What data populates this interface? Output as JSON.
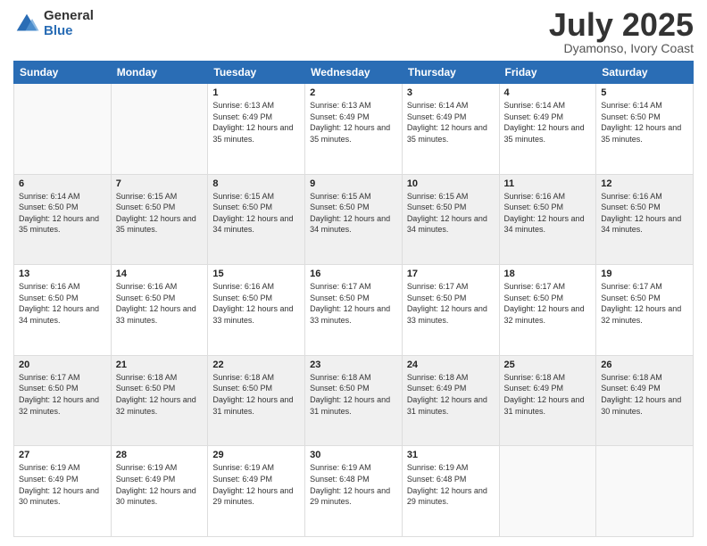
{
  "logo": {
    "general": "General",
    "blue": "Blue"
  },
  "title": {
    "month": "July 2025",
    "location": "Dyamonso, Ivory Coast"
  },
  "weekdays": [
    "Sunday",
    "Monday",
    "Tuesday",
    "Wednesday",
    "Thursday",
    "Friday",
    "Saturday"
  ],
  "weeks": [
    [
      {
        "day": "",
        "sunrise": "",
        "sunset": "",
        "daylight": ""
      },
      {
        "day": "",
        "sunrise": "",
        "sunset": "",
        "daylight": ""
      },
      {
        "day": "1",
        "sunrise": "Sunrise: 6:13 AM",
        "sunset": "Sunset: 6:49 PM",
        "daylight": "Daylight: 12 hours and 35 minutes."
      },
      {
        "day": "2",
        "sunrise": "Sunrise: 6:13 AM",
        "sunset": "Sunset: 6:49 PM",
        "daylight": "Daylight: 12 hours and 35 minutes."
      },
      {
        "day": "3",
        "sunrise": "Sunrise: 6:14 AM",
        "sunset": "Sunset: 6:49 PM",
        "daylight": "Daylight: 12 hours and 35 minutes."
      },
      {
        "day": "4",
        "sunrise": "Sunrise: 6:14 AM",
        "sunset": "Sunset: 6:49 PM",
        "daylight": "Daylight: 12 hours and 35 minutes."
      },
      {
        "day": "5",
        "sunrise": "Sunrise: 6:14 AM",
        "sunset": "Sunset: 6:50 PM",
        "daylight": "Daylight: 12 hours and 35 minutes."
      }
    ],
    [
      {
        "day": "6",
        "sunrise": "Sunrise: 6:14 AM",
        "sunset": "Sunset: 6:50 PM",
        "daylight": "Daylight: 12 hours and 35 minutes."
      },
      {
        "day": "7",
        "sunrise": "Sunrise: 6:15 AM",
        "sunset": "Sunset: 6:50 PM",
        "daylight": "Daylight: 12 hours and 35 minutes."
      },
      {
        "day": "8",
        "sunrise": "Sunrise: 6:15 AM",
        "sunset": "Sunset: 6:50 PM",
        "daylight": "Daylight: 12 hours and 34 minutes."
      },
      {
        "day": "9",
        "sunrise": "Sunrise: 6:15 AM",
        "sunset": "Sunset: 6:50 PM",
        "daylight": "Daylight: 12 hours and 34 minutes."
      },
      {
        "day": "10",
        "sunrise": "Sunrise: 6:15 AM",
        "sunset": "Sunset: 6:50 PM",
        "daylight": "Daylight: 12 hours and 34 minutes."
      },
      {
        "day": "11",
        "sunrise": "Sunrise: 6:16 AM",
        "sunset": "Sunset: 6:50 PM",
        "daylight": "Daylight: 12 hours and 34 minutes."
      },
      {
        "day": "12",
        "sunrise": "Sunrise: 6:16 AM",
        "sunset": "Sunset: 6:50 PM",
        "daylight": "Daylight: 12 hours and 34 minutes."
      }
    ],
    [
      {
        "day": "13",
        "sunrise": "Sunrise: 6:16 AM",
        "sunset": "Sunset: 6:50 PM",
        "daylight": "Daylight: 12 hours and 34 minutes."
      },
      {
        "day": "14",
        "sunrise": "Sunrise: 6:16 AM",
        "sunset": "Sunset: 6:50 PM",
        "daylight": "Daylight: 12 hours and 33 minutes."
      },
      {
        "day": "15",
        "sunrise": "Sunrise: 6:16 AM",
        "sunset": "Sunset: 6:50 PM",
        "daylight": "Daylight: 12 hours and 33 minutes."
      },
      {
        "day": "16",
        "sunrise": "Sunrise: 6:17 AM",
        "sunset": "Sunset: 6:50 PM",
        "daylight": "Daylight: 12 hours and 33 minutes."
      },
      {
        "day": "17",
        "sunrise": "Sunrise: 6:17 AM",
        "sunset": "Sunset: 6:50 PM",
        "daylight": "Daylight: 12 hours and 33 minutes."
      },
      {
        "day": "18",
        "sunrise": "Sunrise: 6:17 AM",
        "sunset": "Sunset: 6:50 PM",
        "daylight": "Daylight: 12 hours and 32 minutes."
      },
      {
        "day": "19",
        "sunrise": "Sunrise: 6:17 AM",
        "sunset": "Sunset: 6:50 PM",
        "daylight": "Daylight: 12 hours and 32 minutes."
      }
    ],
    [
      {
        "day": "20",
        "sunrise": "Sunrise: 6:17 AM",
        "sunset": "Sunset: 6:50 PM",
        "daylight": "Daylight: 12 hours and 32 minutes."
      },
      {
        "day": "21",
        "sunrise": "Sunrise: 6:18 AM",
        "sunset": "Sunset: 6:50 PM",
        "daylight": "Daylight: 12 hours and 32 minutes."
      },
      {
        "day": "22",
        "sunrise": "Sunrise: 6:18 AM",
        "sunset": "Sunset: 6:50 PM",
        "daylight": "Daylight: 12 hours and 31 minutes."
      },
      {
        "day": "23",
        "sunrise": "Sunrise: 6:18 AM",
        "sunset": "Sunset: 6:50 PM",
        "daylight": "Daylight: 12 hours and 31 minutes."
      },
      {
        "day": "24",
        "sunrise": "Sunrise: 6:18 AM",
        "sunset": "Sunset: 6:49 PM",
        "daylight": "Daylight: 12 hours and 31 minutes."
      },
      {
        "day": "25",
        "sunrise": "Sunrise: 6:18 AM",
        "sunset": "Sunset: 6:49 PM",
        "daylight": "Daylight: 12 hours and 31 minutes."
      },
      {
        "day": "26",
        "sunrise": "Sunrise: 6:18 AM",
        "sunset": "Sunset: 6:49 PM",
        "daylight": "Daylight: 12 hours and 30 minutes."
      }
    ],
    [
      {
        "day": "27",
        "sunrise": "Sunrise: 6:19 AM",
        "sunset": "Sunset: 6:49 PM",
        "daylight": "Daylight: 12 hours and 30 minutes."
      },
      {
        "day": "28",
        "sunrise": "Sunrise: 6:19 AM",
        "sunset": "Sunset: 6:49 PM",
        "daylight": "Daylight: 12 hours and 30 minutes."
      },
      {
        "day": "29",
        "sunrise": "Sunrise: 6:19 AM",
        "sunset": "Sunset: 6:49 PM",
        "daylight": "Daylight: 12 hours and 29 minutes."
      },
      {
        "day": "30",
        "sunrise": "Sunrise: 6:19 AM",
        "sunset": "Sunset: 6:48 PM",
        "daylight": "Daylight: 12 hours and 29 minutes."
      },
      {
        "day": "31",
        "sunrise": "Sunrise: 6:19 AM",
        "sunset": "Sunset: 6:48 PM",
        "daylight": "Daylight: 12 hours and 29 minutes."
      },
      {
        "day": "",
        "sunrise": "",
        "sunset": "",
        "daylight": ""
      },
      {
        "day": "",
        "sunrise": "",
        "sunset": "",
        "daylight": ""
      }
    ]
  ]
}
